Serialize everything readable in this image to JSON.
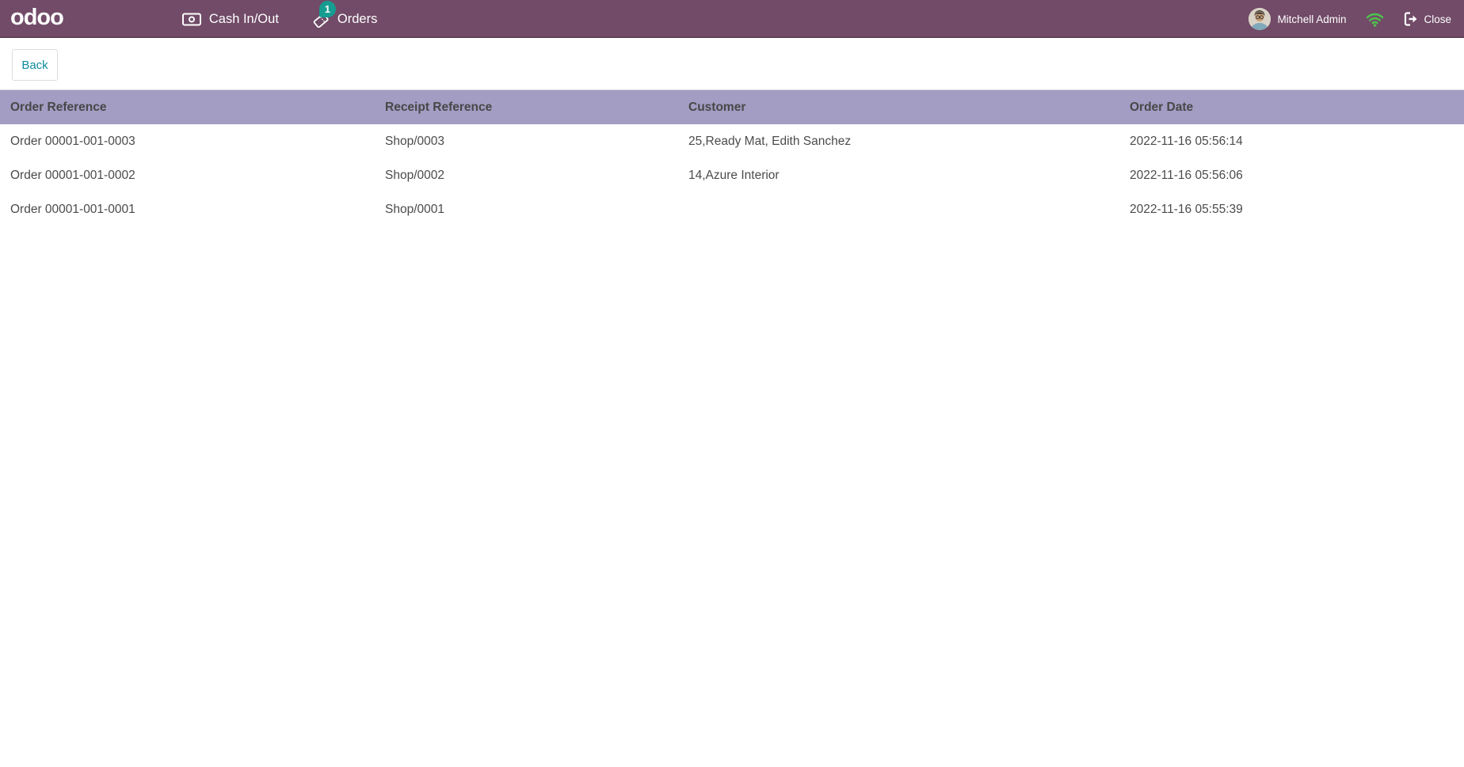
{
  "topbar": {
    "logo": "odoo",
    "cash_label": "Cash In/Out",
    "orders_label": "Orders",
    "orders_badge": "1",
    "user_name": "Mitchell Admin",
    "close_label": "Close"
  },
  "content": {
    "back_label": "Back"
  },
  "table": {
    "headers": [
      "Order Reference",
      "Receipt Reference",
      "Customer",
      "Order Date"
    ],
    "rows": [
      {
        "order_ref": "Order 00001-001-0003",
        "receipt_ref": "Shop/0003",
        "customer": "25,Ready Mat, Edith Sanchez",
        "date": "2022-11-16 05:56:14"
      },
      {
        "order_ref": "Order 00001-001-0002",
        "receipt_ref": "Shop/0002",
        "customer": "14,Azure Interior",
        "date": "2022-11-16 05:56:06"
      },
      {
        "order_ref": "Order 00001-001-0001",
        "receipt_ref": "Shop/0001",
        "customer": "",
        "date": "2022-11-16 05:55:39"
      }
    ]
  },
  "icons": {
    "cash": "money-bill",
    "orders": "ticket",
    "status": "wifi",
    "close": "sign-out",
    "user": "avatar-photo"
  },
  "colors": {
    "topbar_bg": "#714B67",
    "table_header_bg": "#A39CC3",
    "accent_teal": "#0E8C9D",
    "badge_teal": "#169C90",
    "wifi_green": "#4FC04F",
    "text_dark": "#4B4B4B"
  }
}
